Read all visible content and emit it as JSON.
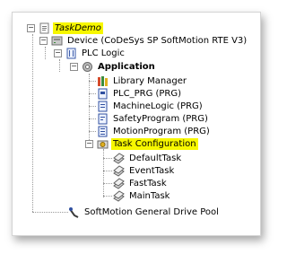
{
  "tree": {
    "root": {
      "label": "TaskDemo",
      "expanded": true,
      "highlighted": true
    },
    "device": {
      "label": "Device (CoDeSys SP SoftMotion RTE V3)",
      "expanded": true
    },
    "plc_logic": {
      "label": "PLC Logic",
      "expanded": true
    },
    "application": {
      "label": "Application",
      "expanded": true
    },
    "library_manager": {
      "label": "Library Manager"
    },
    "pous": [
      {
        "label": "PLC_PRG (PRG)"
      },
      {
        "label": "MachineLogic (PRG)"
      },
      {
        "label": "SafetyProgram (PRG)"
      },
      {
        "label": "MotionProgram (PRG)"
      }
    ],
    "task_configuration": {
      "label": "Task Configuration",
      "expanded": true,
      "highlighted": true
    },
    "tasks": [
      {
        "label": "DefaultTask"
      },
      {
        "label": "EventTask"
      },
      {
        "label": "FastTask"
      },
      {
        "label": "MainTask"
      }
    ],
    "drive_pool": {
      "label": "SoftMotion General Drive Pool"
    },
    "toggle_symbol": "−"
  },
  "colors": {
    "highlight": "#f7f700"
  }
}
